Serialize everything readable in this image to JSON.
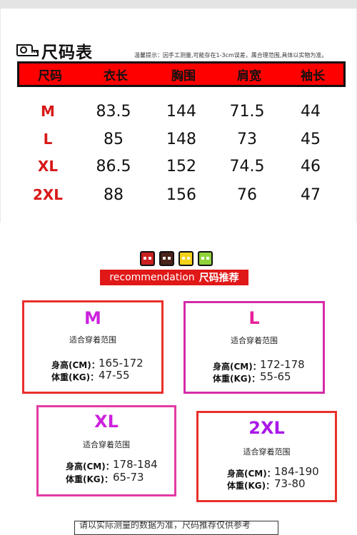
{
  "size_chart": {
    "title": "尺码表",
    "note": "温馨提示：因手工测量,可能存在1-3cm误差，属合理范围,具体以实物为准。",
    "headers": [
      "尺码",
      "衣长",
      "胸围",
      "肩宽",
      "袖长"
    ],
    "rows": [
      [
        "M",
        "83.5",
        "144",
        "71.5",
        "44"
      ],
      [
        "L",
        "85",
        "148",
        "73",
        "45"
      ],
      [
        "XL",
        "86.5",
        "152",
        "74.5",
        "46"
      ],
      [
        "2XL",
        "88",
        "156",
        "76",
        "47"
      ]
    ]
  },
  "recommendation": {
    "banner_en": "recommendation",
    "banner_cn": "尺码推荐",
    "icon_colors": [
      "#cc1f1f",
      "#4a2418",
      "#f3d218",
      "#8fd23a"
    ],
    "cards": [
      {
        "size": "M",
        "color": "#cc22dd",
        "border": "#e8302a",
        "suit_label": "适合穿着范围",
        "height_label": "身高(CM)：",
        "height": "165-172",
        "weight_label": "体重(KG)：",
        "weight": "47-55"
      },
      {
        "size": "L",
        "color": "#e8209a",
        "border": "#d62aa8",
        "suit_label": "适合穿着范围",
        "height_label": "身高(CM)：",
        "height": "172-178",
        "weight_label": "体重(KG)：",
        "weight": "55-65"
      },
      {
        "size": "XL",
        "color": "#cc22dd",
        "border": "#e33aa2",
        "suit_label": "适合穿着范围",
        "height_label": "身高(CM)：",
        "height": "178-184",
        "weight_label": "体重(KG)：",
        "weight": "65-73"
      },
      {
        "size": "2XL",
        "color": "#aa18e8",
        "border": "#e8302a",
        "suit_label": "适合穿着范围",
        "height_label": "身高(CM)：",
        "height": "184-190",
        "weight_label": "体重(KG)：",
        "weight": "73-80"
      }
    ]
  },
  "footer_note": "请以实际测量的数据为准，尺码推荐仅供参考"
}
